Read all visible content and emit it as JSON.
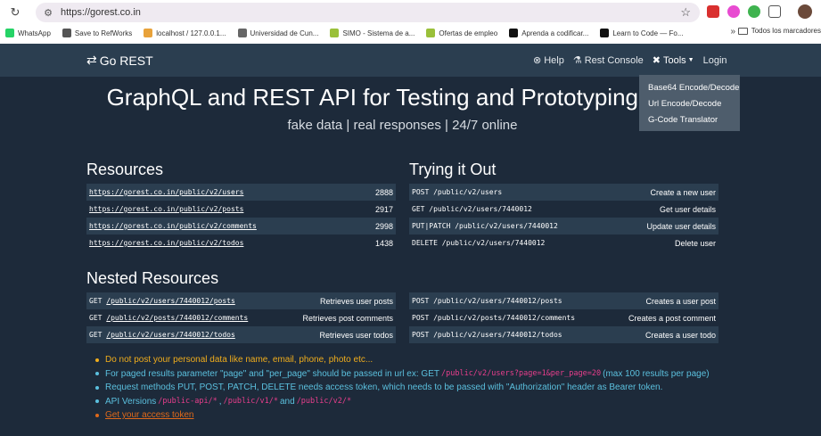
{
  "browser": {
    "url": "https://gorest.co.in",
    "bookmarks": [
      {
        "label": "WhatsApp",
        "color": "#25d366"
      },
      {
        "label": "Save to RefWorks",
        "color": "#555555"
      },
      {
        "label": "localhost / 127.0.0.1...",
        "color": "#e8a23a"
      },
      {
        "label": "Universidad de Cun...",
        "color": "#666666"
      },
      {
        "label": "SIMO - Sistema de a...",
        "color": "#9ac03a"
      },
      {
        "label": "Ofertas de empleo",
        "color": "#9ac03a"
      },
      {
        "label": "Aprenda a codificar...",
        "color": "#111111"
      },
      {
        "label": "Learn to Code — Fo...",
        "color": "#111111"
      }
    ],
    "more_bookmarks": "»",
    "bookmarks_folder": "Todos los marcadores"
  },
  "navbar": {
    "brand": "Go REST",
    "links": [
      {
        "label": "Help",
        "icon": "help-circle-icon"
      },
      {
        "label": "Rest Console",
        "icon": "flask-icon"
      },
      {
        "label": "Tools",
        "icon": "tools-icon"
      },
      {
        "label": "Login",
        "icon": ""
      }
    ],
    "tools_menu": [
      "Base64 Encode/Decode",
      "Url Encode/Decode",
      "G-Code Translator"
    ]
  },
  "hero": {
    "title": "GraphQL and REST API for Testing and Prototyping",
    "subtitle": "fake data | real responses | 24/7 online"
  },
  "resources": {
    "heading": "Resources",
    "rows": [
      {
        "url": "https://gorest.co.in/public/v2/users",
        "count": "2888"
      },
      {
        "url": "https://gorest.co.in/public/v2/posts",
        "count": "2917"
      },
      {
        "url": "https://gorest.co.in/public/v2/comments",
        "count": "2998"
      },
      {
        "url": "https://gorest.co.in/public/v2/todos",
        "count": "1438"
      }
    ]
  },
  "trying": {
    "heading": "Trying it Out",
    "rows": [
      {
        "method": "POST",
        "path": "/public/v2/users",
        "desc": "Create a new user"
      },
      {
        "method": "GET",
        "path": "/public/v2/users/7440012",
        "desc": "Get user details"
      },
      {
        "method": "PUT|PATCH",
        "path": "/public/v2/users/7440012",
        "desc": "Update user details"
      },
      {
        "method": "DELETE",
        "path": "/public/v2/users/7440012",
        "desc": "Delete user"
      }
    ]
  },
  "nested": {
    "heading": "Nested Resources",
    "left": [
      {
        "method": "GET",
        "path": "/public/v2/users/7440012/posts",
        "desc": "Retrieves user posts"
      },
      {
        "method": "GET",
        "path": "/public/v2/posts/7440012/comments",
        "desc": "Retrieves post comments"
      },
      {
        "method": "GET",
        "path": "/public/v2/users/7440012/todos",
        "desc": "Retrieves user todos"
      }
    ],
    "right": [
      {
        "method": "POST",
        "path": "/public/v2/users/7440012/posts",
        "desc": "Creates a user post"
      },
      {
        "method": "POST",
        "path": "/public/v2/posts/7440012/comments",
        "desc": "Creates a post comment"
      },
      {
        "method": "POST",
        "path": "/public/v2/users/7440012/todos",
        "desc": "Creates a user todo"
      }
    ]
  },
  "notes": {
    "privacy": "Do not post your personal data like name, email, phone, photo etc...",
    "paging_pre": "For paged results parameter \"page\" and \"per_page\" should be passed in url ex: GET",
    "paging_code": "/public/v2/users?page=1&per_page=20",
    "paging_post": "(max 100 results per page)",
    "token": "Request methods PUT, POST, PATCH, DELETE needs access token, which needs to be passed with \"Authorization\" header as Bearer token.",
    "versions_pre": "API Versions",
    "versions_code1": "/public-api/*",
    "versions_sep1": ",",
    "versions_code2": "/public/v1/*",
    "versions_sep2": "and",
    "versions_code3": "/public/v2/*",
    "access_token_link": "Get your access token"
  }
}
